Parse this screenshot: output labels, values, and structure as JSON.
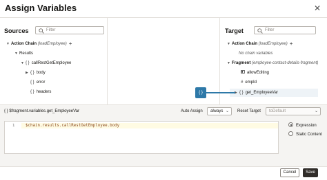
{
  "dialog": {
    "title": "Assign Variables",
    "close_glyph": "✕"
  },
  "sources": {
    "title": "Sources",
    "filter_placeholder": "Filter",
    "tree": {
      "action_chain": {
        "label": "Action Chain",
        "hint": "(loadEmployee)"
      },
      "results": "Results",
      "call": "callRestGetEmployee",
      "body": "body",
      "error": "error",
      "headers": "headers"
    }
  },
  "target": {
    "title": "Target",
    "filter_placeholder": "Filter",
    "tree": {
      "action_chain": {
        "label": "Action Chain",
        "hint": "(loadEmployee)"
      },
      "no_vars": "No chain variables",
      "fragment": {
        "label": "Fragment",
        "hint": "(employee-contact-details-fragment)"
      },
      "allow_editing": "allowEditing",
      "emp_id": "empId",
      "get_employee_var": "get_EmployeeVar"
    }
  },
  "link_glyph": "{ }",
  "expression": {
    "path": "$fragment.variables.get_EmployeeVar",
    "auto_assign_label": "Auto Assign",
    "auto_assign_value": "always",
    "reset_target_label": "Reset Target",
    "reset_target_value": "toDefault",
    "line_number": "1",
    "code": "$chain.results.callRestGetEmployee.body",
    "radio_expression": "Expression",
    "radio_static": "Static Content"
  },
  "footer": {
    "cancel": "Cancel",
    "save": "Save"
  },
  "colors": {
    "accent": "#2e79a8",
    "save_bg": "#312d2a"
  }
}
